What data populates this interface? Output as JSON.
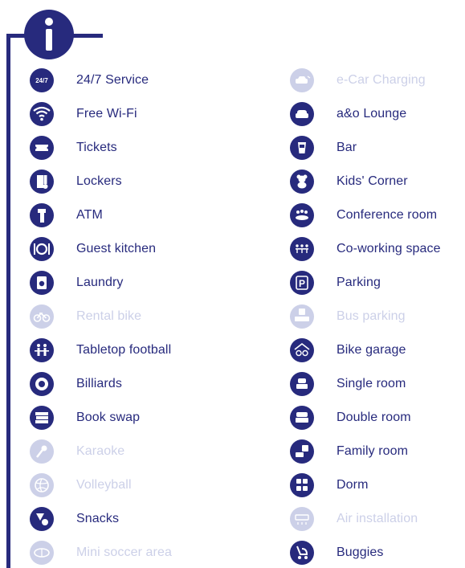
{
  "info_symbol": "i",
  "colors": {
    "active": "#272a7d",
    "inactive": "#ccd0e8"
  },
  "left_column": [
    {
      "label": "24/7 Service",
      "icon": "24-7-icon",
      "badge": "24/7",
      "available": true
    },
    {
      "label": "Free Wi-Fi",
      "icon": "wifi-icon",
      "available": true
    },
    {
      "label": "Tickets",
      "icon": "ticket-icon",
      "available": true
    },
    {
      "label": "Lockers",
      "icon": "locker-icon",
      "available": true
    },
    {
      "label": "ATM",
      "icon": "atm-icon",
      "available": true
    },
    {
      "label": "Guest kitchen",
      "icon": "plate-cutlery-icon",
      "available": true
    },
    {
      "label": "Laundry",
      "icon": "washing-machine-icon",
      "available": true
    },
    {
      "label": "Rental bike",
      "icon": "bike-icon",
      "available": false
    },
    {
      "label": "Tabletop football",
      "icon": "foosball-icon",
      "available": true
    },
    {
      "label": "Billiards",
      "icon": "billiard-ball-icon",
      "available": true
    },
    {
      "label": "Book swap",
      "icon": "books-icon",
      "available": true
    },
    {
      "label": "Karaoke",
      "icon": "microphone-icon",
      "available": false
    },
    {
      "label": "Volleyball",
      "icon": "volleyball-icon",
      "available": false
    },
    {
      "label": "Snacks",
      "icon": "snacks-icon",
      "available": true
    },
    {
      "label": "Mini soccer area",
      "icon": "soccer-field-icon",
      "available": false
    }
  ],
  "right_column": [
    {
      "label": "e-Car Charging",
      "icon": "car-charging-icon",
      "available": false
    },
    {
      "label": "a&o Lounge",
      "icon": "armchair-icon",
      "available": true
    },
    {
      "label": "Bar",
      "icon": "drink-glass-icon",
      "available": true
    },
    {
      "label": "Kids' Corner",
      "icon": "teddy-bear-icon",
      "available": true
    },
    {
      "label": "Conference room",
      "icon": "conference-table-icon",
      "available": true
    },
    {
      "label": "Co-working space",
      "icon": "coworking-icon",
      "available": true
    },
    {
      "label": "Parking",
      "icon": "parking-icon",
      "available": true
    },
    {
      "label": "Bus parking",
      "icon": "bus-parking-icon",
      "available": false
    },
    {
      "label": "Bike garage",
      "icon": "bike-garage-icon",
      "available": true
    },
    {
      "label": "Single room",
      "icon": "single-bed-icon",
      "available": true
    },
    {
      "label": "Double room",
      "icon": "double-bed-icon",
      "available": true
    },
    {
      "label": "Family room",
      "icon": "family-room-icon",
      "available": true
    },
    {
      "label": "Dorm",
      "icon": "dorm-icon",
      "available": true
    },
    {
      "label": "Air installation",
      "icon": "air-conditioner-icon",
      "available": false
    },
    {
      "label": "Buggies",
      "icon": "stroller-icon",
      "available": true
    }
  ]
}
